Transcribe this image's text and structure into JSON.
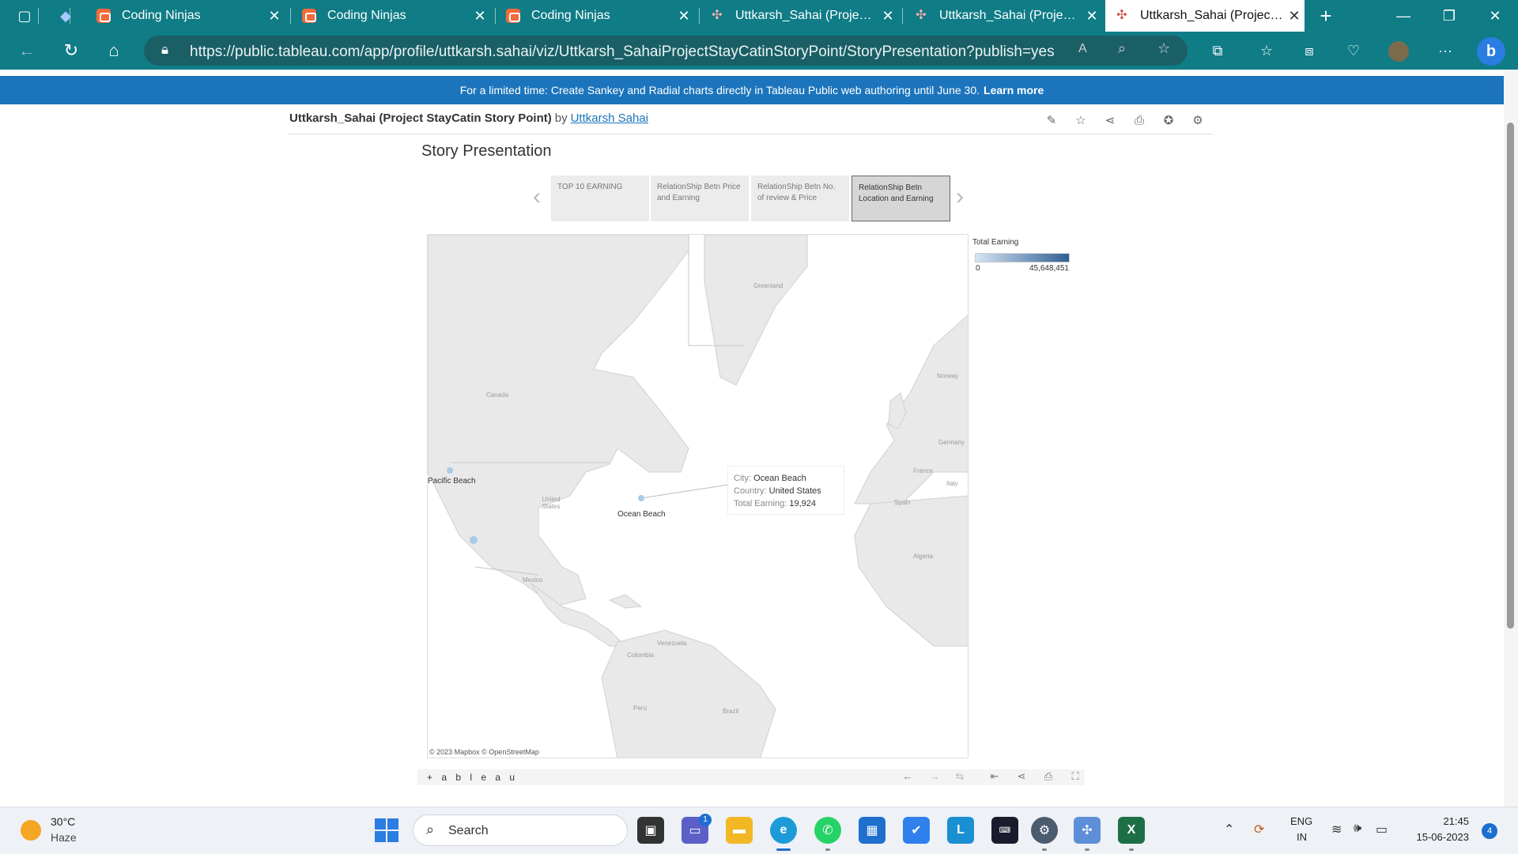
{
  "browser": {
    "tabs": [
      {
        "title": "Coding Ninjas",
        "icon": "coding-ninjas-icon"
      },
      {
        "title": "Coding Ninjas",
        "icon": "coding-ninjas-icon"
      },
      {
        "title": "Coding Ninjas",
        "icon": "coding-ninjas-icon"
      },
      {
        "title": "Uttkarsh_Sahai (Project Sta",
        "icon": "tableau-icon"
      },
      {
        "title": "Uttkarsh_Sahai (Project Sta",
        "icon": "tableau-icon"
      },
      {
        "title": "Uttkarsh_Sahai (Project Sta",
        "icon": "tableau-icon",
        "active": true
      }
    ],
    "url": "https://public.tableau.com/app/profile/uttkarsh.sahai/viz/Uttkarsh_SahaiProjectStayCatinStoryPoint/StoryPresentation?publish=yes",
    "accent": "#0f7c86"
  },
  "banner": {
    "text": "For a limited time: Create Sankey and Radial charts directly in Tableau Public web authoring until June 30.",
    "link": "Learn more"
  },
  "viz": {
    "title": "Uttkarsh_Sahai (Project StayCatin Story Point)",
    "by": "by",
    "author": "Uttkarsh Sahai"
  },
  "story": {
    "title": "Story Presentation",
    "points": [
      {
        "label": "TOP 10 EARNING"
      },
      {
        "label": "RelationShip Betn Price and Earning"
      },
      {
        "label": "RelationShip Betn No. of review & Price"
      },
      {
        "label": "RelationShip Betn Location and Earning",
        "active": true
      }
    ]
  },
  "map": {
    "country_labels": [
      "Greenland",
      "Canada",
      "Norway",
      "Germany",
      "France",
      "Italy",
      "Spain",
      "Algeria",
      "United States",
      "Mexico",
      "Venezuela",
      "Colombia",
      "Peru",
      "Brazil"
    ],
    "city_labels": [
      "Pacific Beach",
      "Ocean Beach"
    ],
    "tooltip": {
      "city_key": "City:",
      "city": "Ocean Beach",
      "country_key": "Country:",
      "country": "United States",
      "earning_key": "Total Earning:",
      "earning": "19,924"
    },
    "credit": "© 2023 Mapbox  © OpenStreetMap",
    "legend": {
      "title": "Total Earning",
      "min": "0",
      "max": "45,648,451"
    }
  },
  "toolbar": {
    "logo": "+ a b l e a u"
  },
  "taskbar": {
    "weather_temp": "30°C",
    "weather_cond": "Haze",
    "search_placeholder": "Search",
    "chat_badge": "1",
    "lang_line1": "ENG",
    "lang_line2": "IN",
    "time": "21:45",
    "date": "15-06-2023",
    "notification_count": "4"
  }
}
